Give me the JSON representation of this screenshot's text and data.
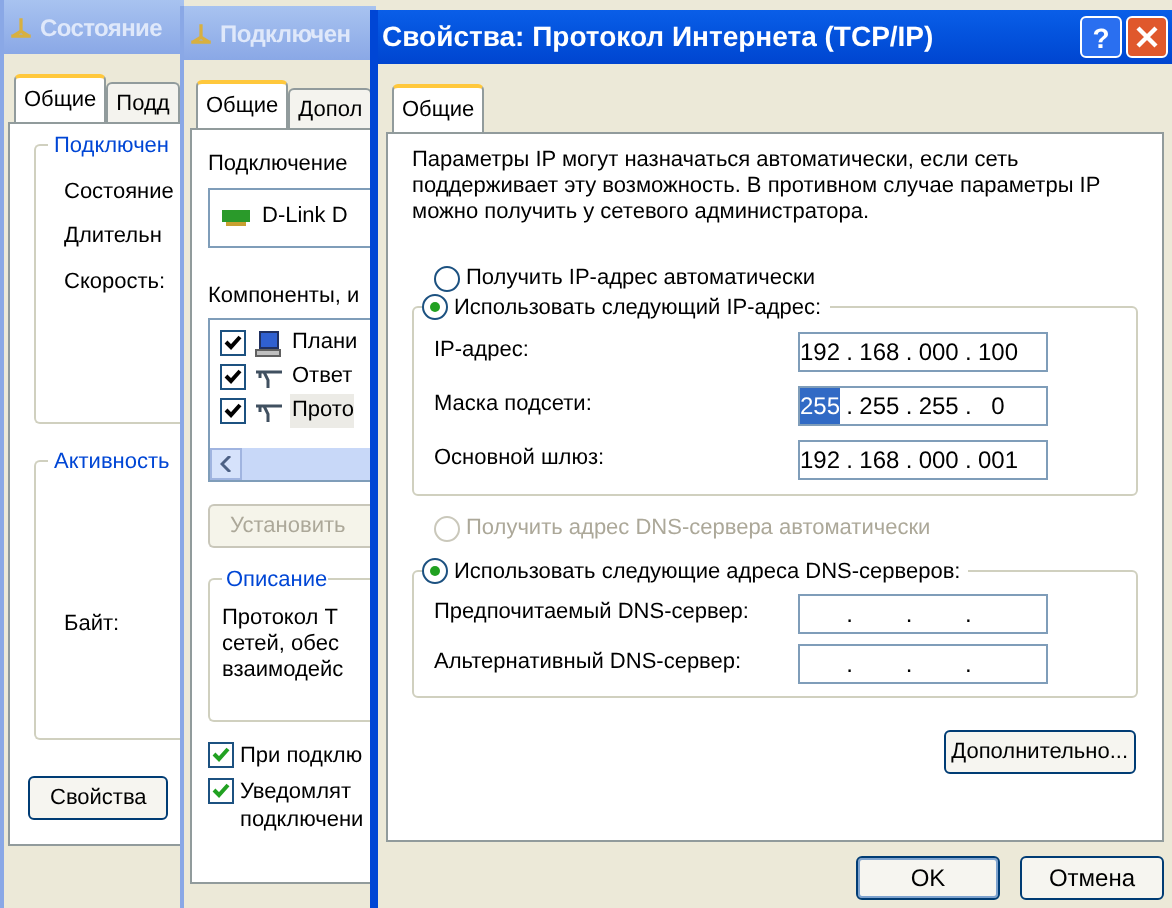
{
  "windows": [
    {
      "kind": "status",
      "title": "Состояние",
      "active": false,
      "tabs": [
        {
          "label": "Общие",
          "selected": true
        },
        {
          "label": "Подд",
          "selected": false
        }
      ],
      "connection_group": {
        "title": "Подключен",
        "rows": [
          "Состояние",
          "Длительн",
          "Скорость:"
        ]
      },
      "activity_group": {
        "title": "Активность",
        "rows": [
          "Байт:"
        ]
      },
      "buttons": [
        "Свойства"
      ]
    },
    {
      "kind": "connection",
      "title": "Подключен",
      "active": false,
      "tabs": [
        {
          "label": "Общие",
          "selected": true
        },
        {
          "label": "Допол",
          "selected": false
        }
      ],
      "connect_using_label": "Подключение",
      "adapter": "D-Link D",
      "components_label": "Компоненты, и",
      "components": [
        {
          "kind": "client",
          "label": "Плани",
          "checked": true,
          "selected": false
        },
        {
          "kind": "protocol",
          "label": "Ответ",
          "checked": true,
          "selected": false
        },
        {
          "kind": "protocol",
          "label": "Прото",
          "checked": true,
          "selected": true
        }
      ],
      "install_button": {
        "label": "Установить",
        "disabled": true
      },
      "description": {
        "title": "Описание",
        "lines": [
          "Протокол Т",
          "сетей, обес",
          "взаимодейс"
        ]
      },
      "options": [
        {
          "lines": [
            "При подклю"
          ],
          "checked": true
        },
        {
          "lines": [
            "Уведомлят",
            "подключени"
          ],
          "checked": true
        }
      ]
    },
    {
      "kind": "tcpip",
      "title": "Свойства: Протокол Интернета (TCP/IP)",
      "active": true,
      "help_button": "?",
      "tabs": [
        {
          "label": "Общие",
          "selected": true
        }
      ],
      "intro": "Параметры IP могут назначаться автоматически, если сеть поддерживает эту возможность. В противном случае параметры IP можно получить у сетевого администратора.",
      "separator": ".",
      "ip_options": [
        {
          "label": "Получить IP-адрес автоматически",
          "selected": false,
          "disabled": false
        },
        {
          "label": "Использовать следующий IP-адрес:",
          "selected": true,
          "disabled": false
        }
      ],
      "ip_fields": [
        {
          "label": "IP-адрес:",
          "parts": [
            {
              "text": "192",
              "selected": false
            },
            {
              "text": "168",
              "selected": false
            },
            {
              "text": "000",
              "selected": false
            },
            {
              "text": "100",
              "selected": false
            }
          ]
        },
        {
          "label": "Маска подсети:",
          "parts": [
            {
              "text": "255",
              "selected": true
            },
            {
              "text": "255",
              "selected": false
            },
            {
              "text": "255",
              "selected": false
            },
            {
              "text": "0",
              "selected": false
            }
          ]
        },
        {
          "label": "Основной шлюз:",
          "parts": [
            {
              "text": "192",
              "selected": false
            },
            {
              "text": "168",
              "selected": false
            },
            {
              "text": "000",
              "selected": false
            },
            {
              "text": "001",
              "selected": false
            }
          ]
        }
      ],
      "dns_options": [
        {
          "label": "Получить адрес DNS-сервера автоматически",
          "selected": false,
          "disabled": true
        },
        {
          "label": "Использовать следующие адреса DNS-серверов:",
          "selected": true,
          "disabled": false
        }
      ],
      "dns_fields": [
        {
          "label": "Предпочитаемый DNS-сервер:"
        },
        {
          "label": "Альтернативный DNS-сервер:"
        }
      ],
      "advanced_button": "Дополнительно...",
      "buttons": [
        "OK",
        "Отмена"
      ]
    }
  ]
}
